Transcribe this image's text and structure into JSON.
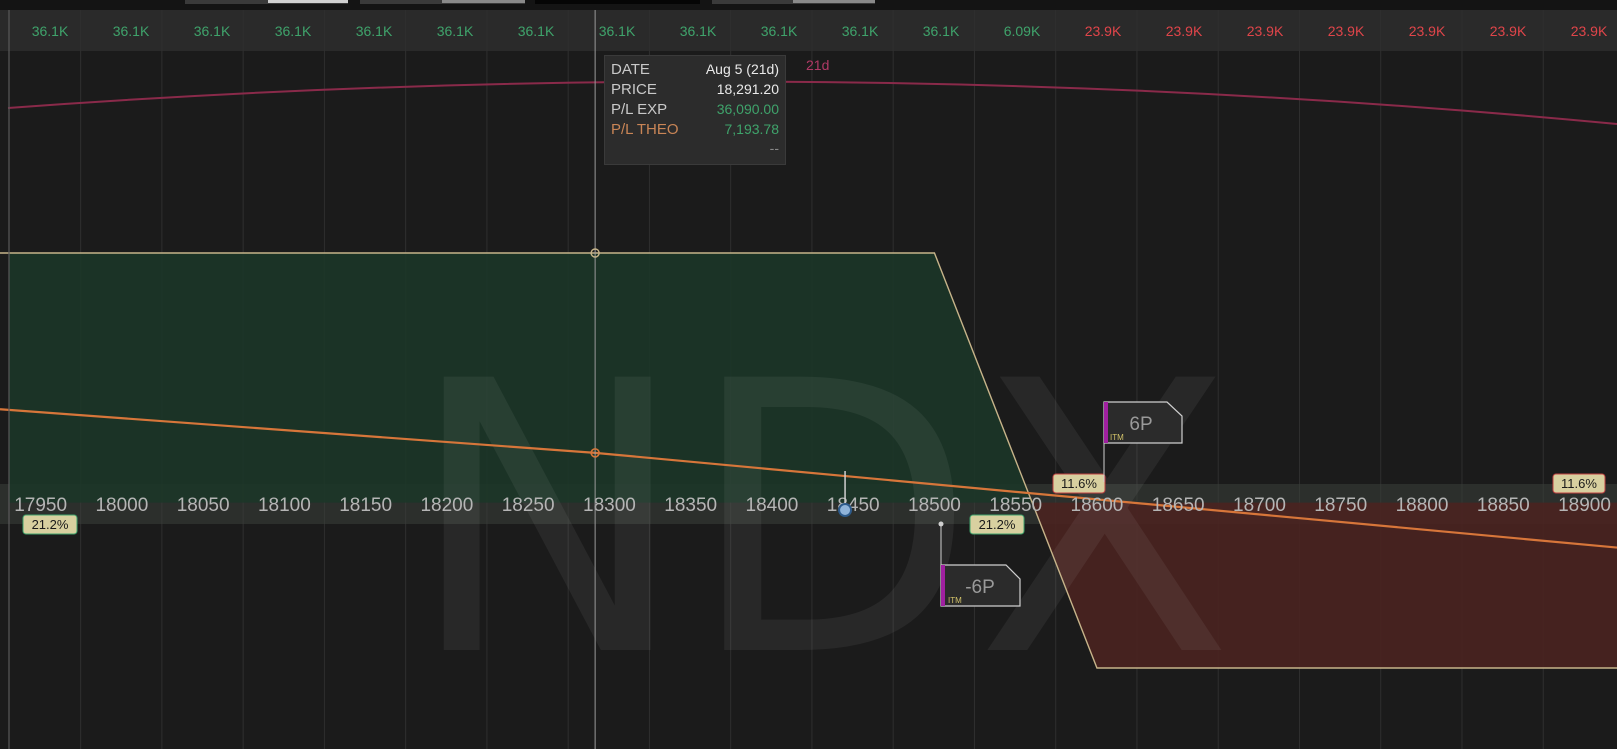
{
  "watermark": "NDX",
  "colors": {
    "background": "#1b1b1b",
    "top_bar": "#2a2a2a",
    "price_axis_band": "#3a3f3b",
    "profit_fill": "#1c3628",
    "loss_fill": "#4a2320",
    "pl_exp_line": "#c7b48a",
    "pl_theo_line": "#d7763a",
    "date_curve": "#8a2a4a",
    "green_text": "#3fa36b",
    "red_text": "#e0454a",
    "label_box": "#d8d0a0"
  },
  "pl_row": {
    "values": [
      "36.1K",
      "36.1K",
      "36.1K",
      "36.1K",
      "36.1K",
      "36.1K",
      "36.1K",
      "36.1K",
      "36.1K",
      "36.1K",
      "36.1K",
      "36.1K",
      "6.09K",
      "23.9K",
      "23.9K",
      "23.9K",
      "23.9K",
      "23.9K",
      "23.9K",
      "23.9K"
    ],
    "status": [
      "gain",
      "gain",
      "gain",
      "gain",
      "gain",
      "gain",
      "gain",
      "gain",
      "gain",
      "gain",
      "gain",
      "gain",
      "gain",
      "loss",
      "loss",
      "loss",
      "loss",
      "loss",
      "loss",
      "loss"
    ]
  },
  "date_curve_label": "21d",
  "tooltip": {
    "date_label": "DATE",
    "date_value": "Aug 5 (21d)",
    "price_label": "PRICE",
    "price_value": "18,291.20",
    "exp_label": "P/L EXP",
    "exp_value": "36,090.00",
    "theo_label": "P/L THEO",
    "theo_value": "7,193.78",
    "extra_value": "--"
  },
  "markers": {
    "left_pct": "21.2%",
    "right_pct": "21.2%",
    "upper_left_pct": "11.6%",
    "upper_right_pct": "11.6%",
    "long_put_label": "6P",
    "short_put_label": "-6P",
    "itm_label": "ITM"
  },
  "chart_data": {
    "type": "line",
    "title": "",
    "xlabel": "",
    "ylabel": "",
    "x_ticks": [
      17950,
      18000,
      18050,
      18100,
      18150,
      18200,
      18250,
      18300,
      18350,
      18400,
      18450,
      18500,
      18550,
      18600,
      18650,
      18700,
      18750,
      18800,
      18850,
      18900
    ],
    "xlim": [
      17925,
      18920
    ],
    "cursor_price": 18291.2,
    "current_price": 18445,
    "strikes": {
      "short_put": 18500,
      "long_put": 18600
    },
    "series": [
      {
        "name": "P/L EXP",
        "x": [
          17925,
          18500,
          18600,
          18920
        ],
        "y": [
          36090,
          36090,
          -23910,
          -23910
        ]
      },
      {
        "name": "P/L THEO",
        "x": [
          17925,
          18291.2,
          18920
        ],
        "y": [
          13500,
          7193.78,
          -6500
        ]
      }
    ],
    "ylim": [
      -23910,
      36090
    ],
    "grid": true
  }
}
